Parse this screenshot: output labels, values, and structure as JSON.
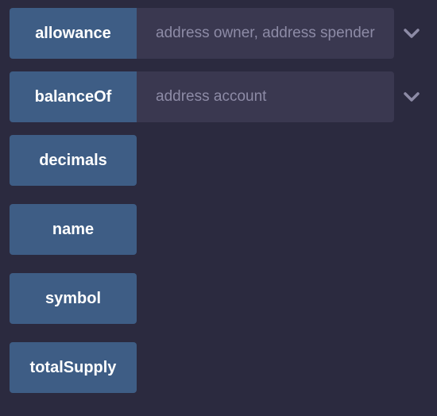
{
  "functions": [
    {
      "label": "allowance",
      "placeholder": "address owner, address spender",
      "has_input": true
    },
    {
      "label": "balanceOf",
      "placeholder": "address account",
      "has_input": true
    },
    {
      "label": "decimals"
    },
    {
      "label": "name"
    },
    {
      "label": "symbol"
    },
    {
      "label": "totalSupply"
    }
  ],
  "icons": {
    "expand": "chevron-down-icon"
  },
  "colors": {
    "background": "#2b2a3f",
    "button": "#3e5d85",
    "input": "#3a3850",
    "chevron": "#8d8ba6"
  }
}
